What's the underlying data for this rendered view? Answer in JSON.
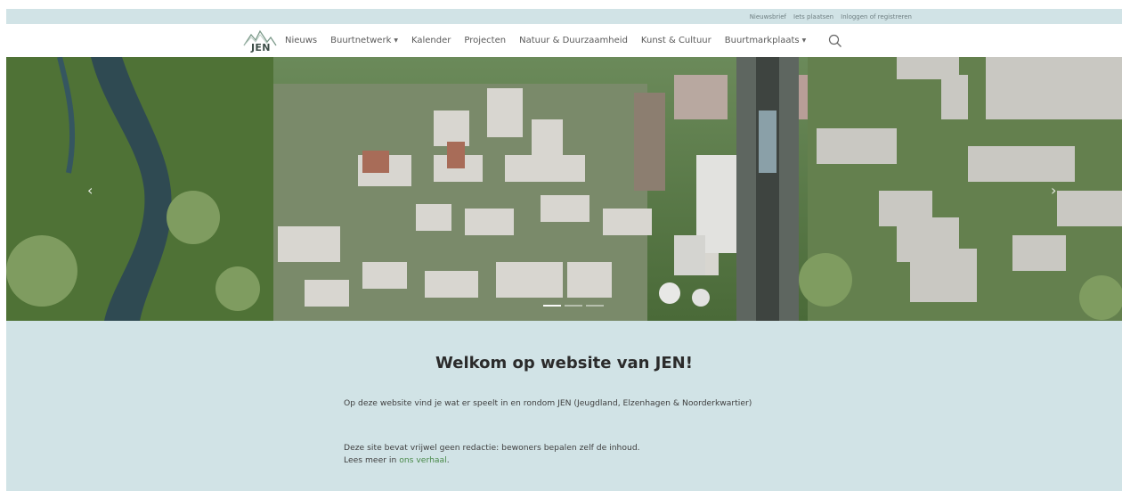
{
  "topbar": {
    "links": [
      "Nieuwsbrief",
      "Iets plaatsen",
      "Inloggen of registreren"
    ]
  },
  "logo": {
    "text": "JEN"
  },
  "nav": {
    "items": [
      {
        "label": "Nieuws"
      },
      {
        "label": "Buurtnetwerk",
        "dropdown": true
      },
      {
        "label": "Kalender"
      },
      {
        "label": "Projecten"
      },
      {
        "label": "Natuur & Duurzaamheid"
      },
      {
        "label": "Kunst & Cultuur"
      },
      {
        "label": "Buurtmarkplaats",
        "dropdown": true
      }
    ],
    "search_icon": "search-icon"
  },
  "hero": {
    "prev_glyph": "‹",
    "next_glyph": "›",
    "slides_count": 3,
    "active_slide": 1
  },
  "intro": {
    "heading": "Welkom op website van JEN!",
    "p1": "Op deze website vind je wat er speelt in en rondom JEN (Jeugdland, Elzenhagen & Noorderkwartier)",
    "p2_line1": "Deze site bevat vrijwel geen redactie: bewoners bepalen zelf de inhoud.",
    "p2_line2_prefix": "Lees meer in ",
    "p2_link": "ons verhaal",
    "p2_suffix": "."
  },
  "colors": {
    "band": "#d1e3e6",
    "link": "#4a8a4a"
  }
}
